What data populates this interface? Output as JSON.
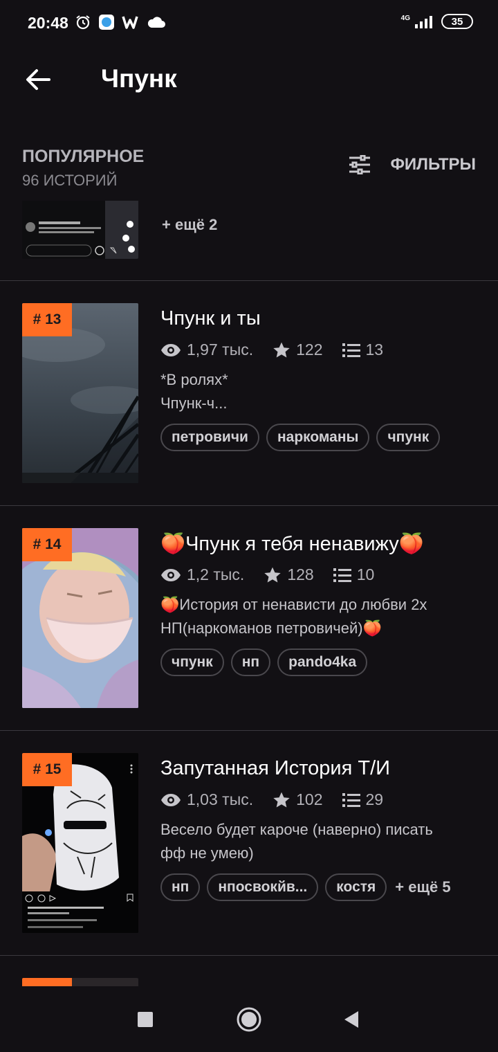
{
  "status": {
    "time": "20:48",
    "network": "4G",
    "battery": "35"
  },
  "appbar": {
    "title": "Чпунк"
  },
  "section": {
    "title": "ПОПУЛЯРНОЕ",
    "count": "96 ИСТОРИЙ",
    "filters_label": "ФИЛЬТРЫ"
  },
  "partial_item": {
    "more": "+ ещё 2"
  },
  "stories": [
    {
      "rank": "# 13",
      "title": "Чпунк и ты",
      "views": "1,97 тыс.",
      "stars": "122",
      "parts": "13",
      "desc_line1": "*В ролях*",
      "desc_line2": "Чпунк-ч...",
      "tags": [
        "петровичи",
        "наркоманы",
        "чпунк"
      ]
    },
    {
      "rank": "# 14",
      "title": "🍑Чпунк я тебя ненавижу🍑",
      "views": "1,2 тыс.",
      "stars": "128",
      "parts": "10",
      "desc_line1": "🍑История от ненависти до любви 2х",
      "desc_line2": "НП(наркоманов петровичей)🍑",
      "tags": [
        "чпунк",
        "нп",
        "pando4ka"
      ]
    },
    {
      "rank": "# 15",
      "title": "Запутанная История Т/И",
      "views": "1,03 тыс.",
      "stars": "102",
      "parts": "29",
      "desc_line1": "Весело будет кароче (наверно) писать",
      "desc_line2": "фф не умею)",
      "tags": [
        "нп",
        "нпосвокйв...",
        "костя"
      ],
      "more": "+ ещё 5"
    }
  ],
  "colors": {
    "accent": "#ff6d23",
    "background": "#121014"
  }
}
